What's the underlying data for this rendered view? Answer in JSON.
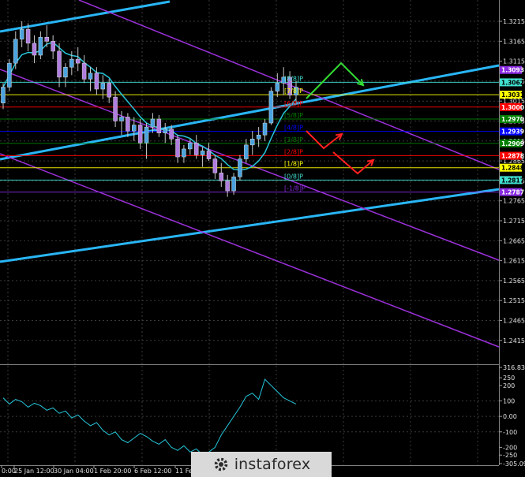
{
  "chart_data": [
    {
      "type": "candlestick",
      "x_tick_labels": [
        "0:00",
        "25 Jan 12:00",
        "30 Jan 04:00",
        "1 Feb 20:00",
        "6 Feb 12:00",
        "11 Feb"
      ],
      "y_tick_labels": [
        "1.3215",
        "1.3165",
        "1.3115",
        "1.3065",
        "1.3015",
        "1.2965",
        "1.2915",
        "1.2865",
        "1.2815",
        "1.2765",
        "1.2715",
        "1.2665",
        "1.2615",
        "1.2565",
        "1.2515",
        "1.2465",
        "1.2415"
      ],
      "price_tags": [
        {
          "label": "1.3093",
          "bg": "#8a2be2",
          "fg": "#ffffff"
        },
        {
          "label": "1.3062",
          "bg": "#40e0d0",
          "fg": "#000000"
        },
        {
          "label": "1.3031",
          "bg": "#ffff00",
          "fg": "#000000"
        },
        {
          "label": "1.3000",
          "bg": "#ff0000",
          "fg": "#ffffff"
        },
        {
          "label": "1.2970",
          "bg": "#008000",
          "fg": "#ffffff"
        },
        {
          "label": "1.2939",
          "bg": "#0000ff",
          "fg": "#ffffff"
        },
        {
          "label": "1.2909",
          "bg": "#008000",
          "fg": "#ffffff"
        },
        {
          "label": "1.2878",
          "bg": "#ff0000",
          "fg": "#ffffff"
        },
        {
          "label": "1.2848",
          "bg": "#ffff00",
          "fg": "#000000"
        },
        {
          "label": "1.2817",
          "bg": "#40e0d0",
          "fg": "#000000"
        },
        {
          "label": "1.2787",
          "bg": "#8a2be2",
          "fg": "#ffffff"
        }
      ],
      "murrey_levels": [
        {
          "label": "[8/8]P",
          "price": 1.3062,
          "color": "#40e0d0"
        },
        {
          "label": "[7/8]P",
          "price": 1.3031,
          "color": "#ffff00"
        },
        {
          "label": "[6/8]P",
          "price": 1.3,
          "color": "#ff0000"
        },
        {
          "label": "[5/8]P",
          "price": 1.297,
          "color": "#008000"
        },
        {
          "label": "[4/8]P",
          "price": 1.2939,
          "color": "#0000ff"
        },
        {
          "label": "[3/8]P",
          "price": 1.2909,
          "color": "#008000"
        },
        {
          "label": "[2/8]P",
          "price": 1.2878,
          "color": "#ff0000"
        },
        {
          "label": "[1/8]P",
          "price": 1.2848,
          "color": "#ffff00"
        },
        {
          "label": "[0/8]P",
          "price": 1.2817,
          "color": "#40e0d0"
        },
        {
          "label": "[-1/8]P",
          "price": 1.2787,
          "color": "#8a2be2"
        }
      ],
      "ohlc": [
        [
          1.301,
          1.306,
          1.2995,
          1.305
        ],
        [
          1.305,
          1.312,
          1.304,
          1.311
        ],
        [
          1.311,
          1.319,
          1.3095,
          1.317
        ],
        [
          1.317,
          1.3215,
          1.315,
          1.3195
        ],
        [
          1.3195,
          1.321,
          1.314,
          1.316
        ],
        [
          1.316,
          1.318,
          1.311,
          1.313
        ],
        [
          1.313,
          1.319,
          1.312,
          1.3175
        ],
        [
          1.3175,
          1.3205,
          1.315,
          1.3165
        ],
        [
          1.3165,
          1.318,
          1.312,
          1.314
        ],
        [
          1.314,
          1.316,
          1.305,
          1.3075
        ],
        [
          1.3075,
          1.311,
          1.305,
          1.31
        ],
        [
          1.31,
          1.314,
          1.308,
          1.312
        ],
        [
          1.312,
          1.315,
          1.309,
          1.311
        ],
        [
          1.311,
          1.313,
          1.306,
          1.307
        ],
        [
          1.307,
          1.31,
          1.304,
          1.3085
        ],
        [
          1.3085,
          1.31,
          1.303,
          1.3045
        ],
        [
          1.3045,
          1.308,
          1.302,
          1.306
        ],
        [
          1.306,
          1.307,
          1.301,
          1.3025
        ],
        [
          1.3025,
          1.304,
          1.295,
          1.2965
        ],
        [
          1.2965,
          1.299,
          1.293,
          1.2975
        ],
        [
          1.2975,
          1.2985,
          1.2925,
          1.294
        ],
        [
          1.294,
          1.2975,
          1.2915,
          1.2955
        ],
        [
          1.2955,
          1.297,
          1.2895,
          1.291
        ],
        [
          1.291,
          1.296,
          1.287,
          1.295
        ],
        [
          1.295,
          1.2985,
          1.2935,
          1.297
        ],
        [
          1.297,
          1.298,
          1.2925,
          1.2935
        ],
        [
          1.2935,
          1.296,
          1.291,
          1.2945
        ],
        [
          1.2945,
          1.2955,
          1.2905,
          1.292
        ],
        [
          1.292,
          1.293,
          1.286,
          1.2875
        ],
        [
          1.2875,
          1.2905,
          1.286,
          1.2895
        ],
        [
          1.2895,
          1.292,
          1.288,
          1.291
        ],
        [
          1.291,
          1.293,
          1.287,
          1.288
        ],
        [
          1.288,
          1.29,
          1.285,
          1.289
        ],
        [
          1.289,
          1.291,
          1.2865,
          1.287
        ],
        [
          1.287,
          1.288,
          1.282,
          1.2835
        ],
        [
          1.2835,
          1.286,
          1.28,
          1.2815
        ],
        [
          1.2815,
          1.283,
          1.2775,
          1.279
        ],
        [
          1.279,
          1.2835,
          1.278,
          1.2825
        ],
        [
          1.2825,
          1.288,
          1.2815,
          1.287
        ],
        [
          1.287,
          1.292,
          1.286,
          1.2905
        ],
        [
          1.2905,
          1.294,
          1.288,
          1.292
        ],
        [
          1.292,
          1.295,
          1.29,
          1.293
        ],
        [
          1.293,
          1.297,
          1.2915,
          1.296
        ],
        [
          1.296,
          1.305,
          1.2955,
          1.304
        ],
        [
          1.304,
          1.3085,
          1.3025,
          1.306
        ],
        [
          1.306,
          1.31,
          1.303,
          1.3075
        ],
        [
          1.3075,
          1.309,
          1.302,
          1.303
        ],
        [
          1.303,
          1.3065,
          1.301,
          1.305
        ]
      ]
    },
    {
      "type": "line",
      "y_tick_labels": [
        "316.8344",
        "250",
        "200",
        "100",
        "0.00",
        "-100",
        "-200",
        "-250",
        "-305.0969"
      ],
      "values": [
        120,
        80,
        110,
        95,
        60,
        85,
        70,
        40,
        55,
        20,
        35,
        -10,
        10,
        -30,
        -60,
        -40,
        -90,
        -120,
        -100,
        -150,
        -170,
        -140,
        -110,
        -130,
        -160,
        -180,
        -150,
        -200,
        -220,
        -190,
        -230,
        -210,
        -250,
        -230,
        -200,
        -120,
        -60,
        0,
        60,
        130,
        150,
        110,
        240,
        200,
        160,
        120,
        100,
        80
      ]
    }
  ]
}
